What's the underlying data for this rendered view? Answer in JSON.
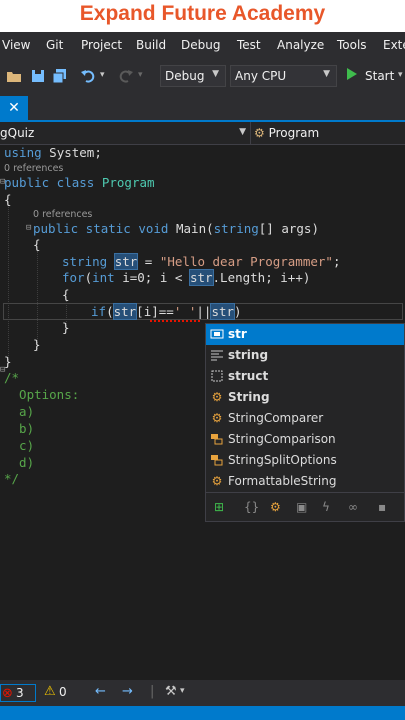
{
  "banner": {
    "title": "Expand Future Academy"
  },
  "menu": {
    "items": [
      "View",
      "Git",
      "Project",
      "Build",
      "Debug",
      "Test",
      "Analyze",
      "Tools",
      "Exte"
    ]
  },
  "toolbar": {
    "config": "Debug",
    "platform": "Any CPU",
    "start_label": "Start",
    "icons": [
      "open-folder-icon",
      "save-icon",
      "save-all-icon",
      "undo-icon",
      "redo-icon",
      "play-icon"
    ]
  },
  "tab": {
    "close_glyph": "✕"
  },
  "navbar": {
    "project": "gQuiz",
    "class_member": "Program"
  },
  "code": {
    "l1_kw": "using",
    "l1_rest": " System;",
    "refs0": "0 references",
    "l2_kw": "public class",
    "l2_ty": "Program",
    "l3": "{",
    "refs1": "0 references",
    "l4_kw": "public static void",
    "l4_main": " Main(",
    "l4_kw2": "string",
    "l4_rest": "[] args)",
    "l5": "{",
    "l6_kw": "string",
    "l6_var": "str",
    "l6_eq": " = ",
    "l6_str": "\"Hello dear Programmer\"",
    "l6_end": ";",
    "l7_kw": "for",
    "l7_a": "(",
    "l7_kw2": "int",
    "l7_b": " i=0; i < ",
    "l7_var": "str",
    "l7_c": ".Length; i++)",
    "l8": "{",
    "l9_kw": "if",
    "l9_a": "(",
    "l9_var": "str",
    "l9_b": "[i]==",
    "l9_str": "' '",
    "l9_c": "||",
    "l9_var2": "str",
    "l9_d": ")",
    "l10": "}",
    "l11": "}",
    "l12": "}",
    "c1": "/*",
    "c2": "  Options:",
    "c3": "  a)",
    "c4": "  b)",
    "c5": "  c)",
    "c6": "  d)",
    "c7": "*/"
  },
  "autocomplete": {
    "items": [
      {
        "label": "str",
        "icon": "local-variable-icon",
        "selected": true
      },
      {
        "label": "string",
        "icon": "keyword-icon",
        "selected": false
      },
      {
        "label": "struct",
        "icon": "snippet-icon",
        "selected": false
      },
      {
        "label": "String",
        "icon": "class-icon",
        "selected": false
      },
      {
        "label": "StringComparer",
        "icon": "class-icon",
        "selected": false
      },
      {
        "label": "StringComparison",
        "icon": "enum-icon",
        "selected": false
      },
      {
        "label": "StringSplitOptions",
        "icon": "enum-icon",
        "selected": false
      },
      {
        "label": "FormattableString",
        "icon": "class-icon",
        "selected": false
      }
    ],
    "filters": [
      "add-import-icon",
      "namespace-filter-icon",
      "class-filter-icon",
      "struct-filter-icon",
      "event-filter-icon",
      "delegate-filter-icon",
      "module-filter-icon"
    ]
  },
  "status": {
    "errors": "3",
    "warnings": "0"
  },
  "colors": {
    "accent": "#007acc",
    "brand": "#e8572a"
  }
}
